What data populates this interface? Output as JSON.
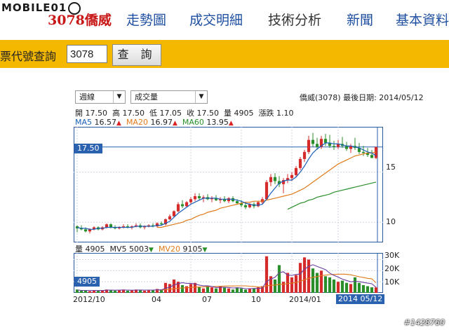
{
  "logo": {
    "text": "MOBILE01"
  },
  "nav": {
    "items": [
      {
        "label": "3078僑威",
        "active": true
      },
      {
        "label": "走勢圖",
        "active": false
      },
      {
        "label": "成交明細",
        "active": false
      },
      {
        "label": "技術分析",
        "active": false
      },
      {
        "label": "新聞",
        "active": false
      },
      {
        "label": "基本資料",
        "active": false
      }
    ]
  },
  "search": {
    "label": "股票代號查詢",
    "value": "3078",
    "button_label": "查 詢"
  },
  "chart_controls": {
    "period_select": "週線",
    "indicator_select": "成交量",
    "stock_info": "僑威(3078)  最後日期: 2014/05/12"
  },
  "quote": {
    "open_label": "開",
    "open": "17.50",
    "high_label": "高",
    "high": "17.50",
    "low_label": "低",
    "low": "17.05",
    "close_label": "收",
    "close": "17.50",
    "volume_label": "量",
    "volume": "4905",
    "change_label": "漲跌",
    "change": "1.10"
  },
  "ma_legend": {
    "ma5_label": "MA5",
    "ma5": "16.57",
    "ma20_label": "MA20",
    "ma20": "16.97",
    "ma60_label": "MA60",
    "ma60": "13.95"
  },
  "vol_legend": {
    "vol_label": "量",
    "vol": "4905",
    "mv5_label": "MV5",
    "mv5": "5003",
    "mv20_label": "MV20",
    "mv20": "9105"
  },
  "price_axis": {
    "ticks": [
      "15",
      "10"
    ],
    "current_tag": "17.50"
  },
  "volume_axis": {
    "ticks": [
      "30K",
      "20K",
      "10K"
    ],
    "current_tag": "4905"
  },
  "time_axis": {
    "ticks": [
      "2012/10",
      "04",
      "07",
      "10",
      "2014/01"
    ],
    "last_date": "2014 05/12"
  },
  "watermark": "#1428760",
  "colors": {
    "up": "#d52b2b",
    "down": "#2a8f2a",
    "ma5": "#1b5fb8",
    "ma20": "#e07a1a",
    "ma60": "#2a8f2a",
    "accent": "#2b57a0",
    "searchbar": "#f5b800",
    "nav_active": "#c81818",
    "nav": "#1f4fa0"
  },
  "chart_data": [
    {
      "type": "candlestick",
      "title": "僑威(3078) 週線",
      "ylim": [
        8,
        19.5
      ],
      "candles": [
        [
          9.6,
          9.7,
          9.0,
          9.4
        ],
        [
          9.4,
          9.7,
          9.2,
          9.3
        ],
        [
          9.3,
          9.5,
          9.0,
          9.1
        ],
        [
          9.1,
          9.4,
          8.9,
          9.3
        ],
        [
          9.3,
          9.6,
          9.2,
          9.5
        ],
        [
          9.5,
          9.6,
          9.2,
          9.3
        ],
        [
          9.3,
          9.6,
          9.2,
          9.5
        ],
        [
          9.5,
          9.9,
          9.4,
          9.8
        ],
        [
          9.8,
          9.9,
          9.4,
          9.5
        ],
        [
          9.5,
          9.7,
          9.3,
          9.4
        ],
        [
          9.4,
          9.6,
          9.3,
          9.5
        ],
        [
          9.5,
          9.8,
          9.4,
          9.6
        ],
        [
          9.6,
          9.8,
          9.4,
          9.5
        ],
        [
          9.5,
          9.7,
          9.3,
          9.6
        ],
        [
          9.6,
          9.9,
          9.5,
          9.7
        ],
        [
          9.7,
          9.9,
          9.4,
          9.5
        ],
        [
          9.5,
          9.7,
          9.3,
          9.6
        ],
        [
          9.6,
          9.8,
          9.5,
          9.7
        ],
        [
          9.7,
          9.9,
          9.5,
          9.6
        ],
        [
          9.6,
          10.0,
          9.5,
          9.9
        ],
        [
          9.9,
          10.1,
          9.7,
          9.8
        ],
        [
          9.8,
          10.4,
          9.7,
          10.3
        ],
        [
          10.3,
          10.8,
          10.2,
          10.6
        ],
        [
          10.6,
          11.2,
          10.5,
          11.1
        ],
        [
          11.1,
          12.0,
          11.0,
          11.8
        ],
        [
          11.8,
          12.2,
          11.4,
          11.6
        ],
        [
          11.6,
          12.1,
          11.5,
          12.0
        ],
        [
          12.0,
          12.5,
          11.8,
          12.3
        ],
        [
          12.3,
          12.9,
          12.1,
          12.6
        ],
        [
          12.6,
          12.9,
          12.2,
          12.4
        ],
        [
          12.4,
          12.7,
          12.0,
          12.5
        ],
        [
          12.5,
          12.8,
          12.2,
          12.3
        ],
        [
          12.3,
          12.6,
          12.0,
          12.4
        ],
        [
          12.4,
          12.7,
          12.1,
          12.2
        ],
        [
          12.2,
          12.5,
          11.9,
          12.3
        ],
        [
          12.3,
          12.6,
          12.0,
          12.1
        ],
        [
          12.1,
          12.5,
          11.9,
          12.4
        ],
        [
          12.4,
          12.6,
          12.0,
          12.1
        ],
        [
          12.1,
          12.3,
          11.8,
          11.9
        ],
        [
          11.9,
          12.2,
          11.5,
          11.7
        ],
        [
          11.7,
          12.0,
          11.3,
          11.5
        ],
        [
          11.5,
          11.9,
          11.4,
          11.8
        ],
        [
          11.8,
          12.0,
          11.4,
          11.6
        ],
        [
          11.6,
          12.1,
          11.5,
          12.0
        ],
        [
          12.0,
          12.5,
          11.8,
          12.3
        ],
        [
          12.3,
          14.2,
          12.2,
          14.0
        ],
        [
          14.0,
          14.8,
          13.6,
          14.5
        ],
        [
          14.5,
          14.9,
          13.8,
          14.1
        ],
        [
          14.1,
          14.6,
          13.5,
          13.8
        ],
        [
          13.8,
          14.4,
          12.9,
          14.2
        ],
        [
          14.2,
          14.8,
          13.9,
          14.4
        ],
        [
          14.4,
          15.0,
          14.1,
          14.7
        ],
        [
          14.7,
          15.6,
          14.5,
          15.4
        ],
        [
          15.4,
          16.5,
          15.2,
          16.3
        ],
        [
          16.3,
          17.2,
          16.0,
          17.0
        ],
        [
          17.0,
          18.6,
          16.8,
          18.2
        ],
        [
          18.2,
          18.9,
          17.5,
          17.8
        ],
        [
          17.8,
          18.4,
          17.2,
          17.5
        ],
        [
          17.5,
          18.6,
          17.3,
          18.3
        ],
        [
          18.3,
          18.8,
          17.6,
          17.9
        ],
        [
          17.9,
          18.7,
          17.4,
          17.6
        ],
        [
          17.6,
          18.1,
          17.2,
          17.5
        ],
        [
          17.5,
          18.2,
          17.3,
          17.8
        ],
        [
          17.8,
          18.5,
          17.4,
          17.6
        ],
        [
          17.6,
          18.0,
          17.1,
          17.3
        ],
        [
          17.3,
          17.8,
          16.9,
          17.6
        ],
        [
          17.6,
          18.4,
          17.2,
          17.4
        ],
        [
          17.4,
          17.9,
          16.8,
          17.0
        ],
        [
          17.0,
          17.6,
          16.6,
          16.9
        ],
        [
          16.9,
          17.4,
          16.5,
          16.7
        ],
        [
          16.7,
          17.2,
          16.4,
          16.4
        ],
        [
          16.4,
          17.5,
          16.3,
          17.5
        ]
      ],
      "ma5": [
        9.5,
        9.4,
        9.4,
        9.3,
        9.3,
        9.4,
        9.4,
        9.5,
        9.5,
        9.5,
        9.5,
        9.5,
        9.5,
        9.5,
        9.6,
        9.6,
        9.6,
        9.6,
        9.6,
        9.7,
        9.7,
        9.9,
        10.1,
        10.5,
        10.9,
        11.2,
        11.5,
        11.8,
        12.0,
        12.2,
        12.4,
        12.4,
        12.4,
        12.4,
        12.3,
        12.3,
        12.3,
        12.3,
        12.2,
        12.1,
        11.9,
        11.8,
        11.7,
        11.7,
        11.8,
        12.3,
        12.9,
        13.4,
        13.9,
        14.1,
        14.2,
        14.2,
        14.5,
        15.0,
        15.6,
        16.3,
        16.9,
        17.3,
        17.6,
        17.9,
        17.9,
        17.8,
        17.8,
        17.7,
        17.6,
        17.6,
        17.5,
        17.4,
        17.2,
        17.0,
        16.9,
        16.6
      ],
      "ma20": [
        null,
        null,
        null,
        null,
        null,
        null,
        null,
        null,
        null,
        null,
        null,
        null,
        null,
        null,
        null,
        null,
        null,
        null,
        null,
        9.5,
        9.5,
        9.6,
        9.7,
        9.8,
        9.9,
        10.0,
        10.2,
        10.3,
        10.5,
        10.7,
        10.8,
        11.0,
        11.1,
        11.2,
        11.4,
        11.5,
        11.6,
        11.7,
        11.8,
        11.9,
        12.0,
        12.0,
        12.1,
        12.1,
        12.1,
        12.2,
        12.3,
        12.4,
        12.5,
        12.6,
        12.7,
        12.8,
        13.0,
        13.2,
        13.4,
        13.7,
        14.0,
        14.3,
        14.6,
        14.9,
        15.2,
        15.5,
        15.8,
        16.0,
        16.2,
        16.4,
        16.6,
        16.7,
        16.8,
        16.9,
        16.9,
        17.0
      ],
      "ma60": [
        null,
        null,
        null,
        null,
        null,
        null,
        null,
        null,
        null,
        null,
        null,
        null,
        null,
        null,
        null,
        null,
        null,
        null,
        null,
        null,
        null,
        null,
        null,
        null,
        null,
        null,
        null,
        null,
        null,
        null,
        null,
        null,
        null,
        null,
        null,
        null,
        null,
        null,
        null,
        null,
        null,
        null,
        null,
        null,
        null,
        null,
        null,
        null,
        null,
        null,
        11.3,
        11.5,
        11.7,
        11.9,
        12.0,
        12.2,
        12.3,
        12.5,
        12.6,
        12.7,
        12.8,
        13.0,
        13.1,
        13.2,
        13.3,
        13.4,
        13.5,
        13.6,
        13.7,
        13.8,
        13.9,
        14.0
      ],
      "volume": [
        3000,
        2000,
        2500,
        1500,
        2000,
        2000,
        2500,
        3000,
        2500,
        2000,
        2500,
        3000,
        2000,
        2500,
        3000,
        2500,
        2000,
        2500,
        2500,
        3500,
        3000,
        9000,
        8000,
        12000,
        10000,
        7000,
        6000,
        8000,
        9000,
        5000,
        4000,
        6000,
        5000,
        4000,
        6000,
        5000,
        4000,
        3000,
        5000,
        4000,
        3000,
        4000,
        4000,
        5000,
        6000,
        33000,
        15000,
        12000,
        25000,
        10000,
        18000,
        14000,
        16000,
        27000,
        32000,
        30000,
        22000,
        18000,
        20000,
        15000,
        14000,
        12000,
        10000,
        11000,
        9000,
        8000,
        14000,
        9000,
        7000,
        6000,
        5000,
        4905
      ],
      "mv5": [
        2500,
        2300,
        2200,
        2100,
        2200,
        2100,
        2100,
        2400,
        2500,
        2400,
        2500,
        2600,
        2500,
        2400,
        2500,
        2600,
        2500,
        2500,
        2500,
        2700,
        2700,
        4100,
        5200,
        7100,
        8400,
        9200,
        8600,
        8600,
        8000,
        7000,
        6400,
        6400,
        5800,
        4800,
        5000,
        5000,
        4800,
        4400,
        4600,
        4400,
        3800,
        3800,
        4000,
        4000,
        4400,
        10400,
        12400,
        14000,
        18200,
        19000,
        16000,
        15800,
        16600,
        17000,
        21400,
        23800,
        25400,
        23800,
        22400,
        21000,
        17800,
        15800,
        14200,
        12400,
        11200,
        10000,
        10400,
        10200,
        9400,
        8800,
        8200,
        5003
      ],
      "mv20": [
        null,
        null,
        null,
        null,
        null,
        null,
        null,
        null,
        null,
        null,
        null,
        null,
        null,
        null,
        null,
        null,
        null,
        null,
        null,
        2500,
        2600,
        2900,
        3200,
        3700,
        4100,
        4400,
        4600,
        4900,
        5200,
        5300,
        5400,
        5600,
        5700,
        5800,
        6000,
        6100,
        6200,
        6200,
        6300,
        6300,
        6300,
        6000,
        5800,
        5400,
        5200,
        6400,
        6800,
        7000,
        7700,
        7800,
        8400,
        8800,
        9400,
        10500,
        11800,
        13100,
        14000,
        14700,
        15500,
        16000,
        16400,
        16600,
        16800,
        16900,
        16700,
        16300,
        15400,
        14500,
        13800,
        13100,
        12700,
        9105
      ],
      "x_ticks": [
        "2012/10",
        "04",
        "07",
        "10",
        "2014/01"
      ],
      "y_ticks": [
        "15",
        "10"
      ],
      "vol_ticks": [
        "30K",
        "20K",
        "10K"
      ]
    }
  ]
}
